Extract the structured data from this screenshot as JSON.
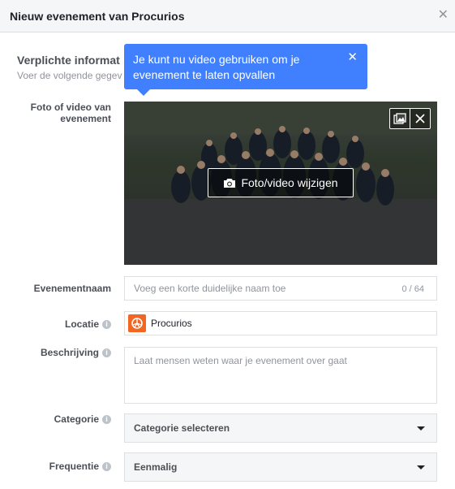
{
  "dialog": {
    "title": "Nieuw evenement van Procurios",
    "close_icon": "close-icon"
  },
  "section": {
    "title": "Verplichte informat",
    "subtitle": "Voer de volgende gegev"
  },
  "tooltip": {
    "text": "Je kunt nu video gebruiken om je evenement te laten opvallen",
    "bg_color": "#4080ff"
  },
  "photo": {
    "label": "Foto of video van evenement",
    "change_button": "Foto/video wijzigen"
  },
  "fields": {
    "name": {
      "label": "Evenementnaam",
      "placeholder": "Voeg een korte duidelijke naam toe",
      "counter": "0 / 64"
    },
    "location": {
      "label": "Locatie",
      "value": "Procurios",
      "brand_color": "#f26522"
    },
    "description": {
      "label": "Beschrijving",
      "placeholder": "Laat mensen weten waar je evenement over gaat"
    },
    "category": {
      "label": "Categorie",
      "selected": "Categorie selecteren"
    },
    "frequency": {
      "label": "Frequentie",
      "selected": "Eenmalig"
    }
  }
}
